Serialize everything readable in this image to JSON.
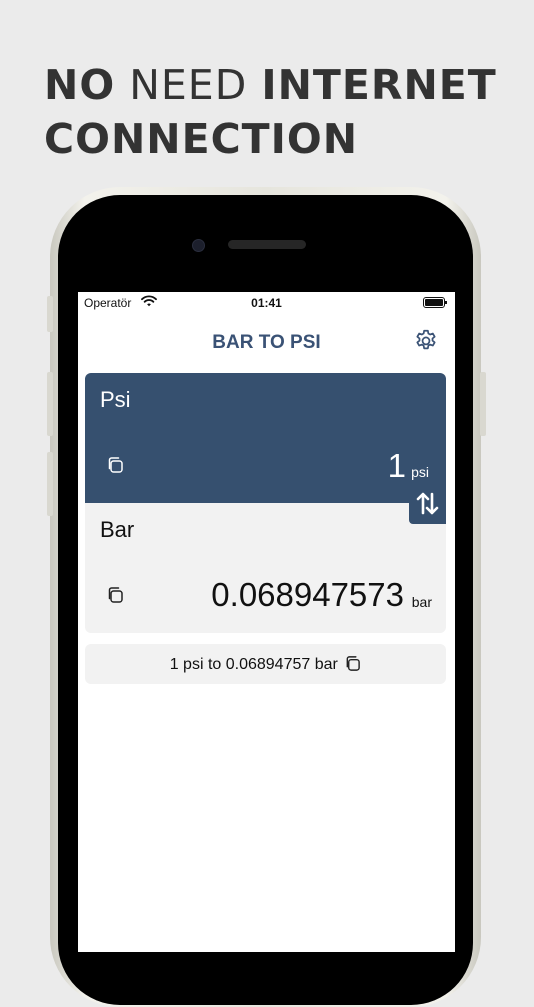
{
  "promo": {
    "headline_bold_1": "NO",
    "headline_light": "NEED",
    "headline_bold_2": "INTERNET",
    "headline_bold_3": "CONNECTION"
  },
  "status_bar": {
    "carrier": "Operatör",
    "time": "01:41",
    "icons": [
      "wifi-icon",
      "battery-icon"
    ]
  },
  "nav": {
    "title": "BAR TO PSI",
    "settings_icon": "gear-icon"
  },
  "converter": {
    "from": {
      "label": "Psi",
      "value": "1",
      "unit": "psi",
      "copy_icon": "copy-icon"
    },
    "to": {
      "label": "Bar",
      "value": "0.068947573",
      "unit": "bar",
      "copy_icon": "copy-icon"
    },
    "swap_icon": "swap-vertical-icon",
    "result_text": "1 psi to 0.06894757 bar",
    "result_copy_icon": "copy-icon"
  },
  "colors": {
    "accent": "#36506f",
    "title": "#3a5275",
    "background": "#ebebeb",
    "card_light": "#f2f2f2"
  }
}
